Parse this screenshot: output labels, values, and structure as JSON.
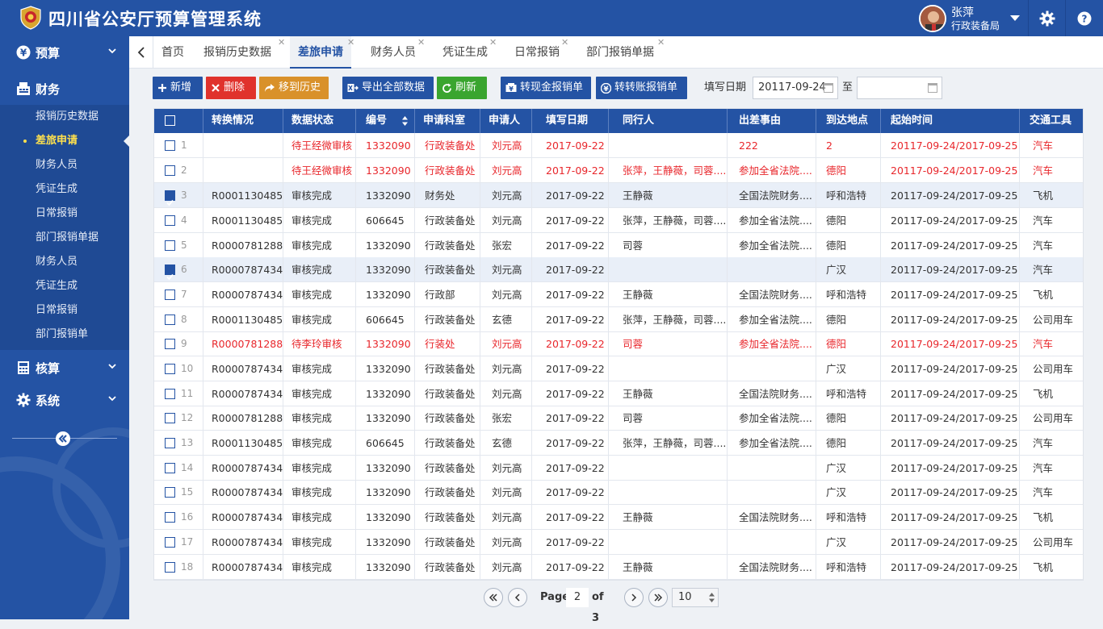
{
  "header": {
    "title": "四川省公安厅预算管理系统",
    "user_name": "张萍",
    "user_dept": "行政装备局"
  },
  "sidebar": {
    "groups": [
      {
        "label": "预算",
        "icon": "yen-circle-icon"
      },
      {
        "label": "财务",
        "icon": "cash-register-icon"
      },
      {
        "label": "核算",
        "icon": "calculator-icon"
      },
      {
        "label": "系统",
        "icon": "gear-icon"
      }
    ],
    "items": [
      {
        "label": "报销历史数据"
      },
      {
        "label": "差旅申请",
        "active": true
      },
      {
        "label": "财务人员"
      },
      {
        "label": "凭证生成"
      },
      {
        "label": "日常报销"
      },
      {
        "label": "部门报销单据"
      },
      {
        "label": "财务人员"
      },
      {
        "label": "凭证生成"
      },
      {
        "label": "日常报销"
      },
      {
        "label": "部门报销单"
      }
    ]
  },
  "tabs": [
    {
      "label": "首页",
      "closable": false
    },
    {
      "label": "报销历史数据",
      "closable": true
    },
    {
      "label": "差旅申请",
      "closable": true,
      "active": true
    },
    {
      "label": "财务人员",
      "closable": true
    },
    {
      "label": "凭证生成",
      "closable": true
    },
    {
      "label": "日常报销",
      "closable": true
    },
    {
      "label": "部门报销单据",
      "closable": true
    }
  ],
  "toolbar": {
    "add": "新增",
    "delete": "删除",
    "move_history": "移到历史",
    "export_all": "导出全部数据",
    "refresh": "刷新",
    "to_cash": "转现金报销单",
    "to_transfer": "转转账报销单",
    "date_label": "填写日期",
    "date_from": "20117-09-24",
    "date_to": "",
    "to_label": "至",
    "colors": {
      "add": "#2453a4",
      "delete": "#e0322c",
      "move": "#d9912a",
      "export": "#2453a4",
      "refresh": "#3aa52f",
      "to_cash": "#2453a4",
      "to_transfer": "#2453a4"
    }
  },
  "table": {
    "columns": [
      "转换情况",
      "数据状态",
      "编号",
      "申请科室",
      "申请人",
      "填写日期",
      "同行人",
      "出差事由",
      "到达地点",
      "起始时间",
      "交通工具"
    ],
    "rows": [
      {
        "n": "1",
        "checked": false,
        "red": true,
        "cells": [
          "",
          "待王经微审核",
          "1332090",
          "行政装备处",
          "刘元高",
          "2017-09-22",
          "",
          "222",
          "2",
          "20117-09-24/2017-09-25",
          "汽车"
        ]
      },
      {
        "n": "2",
        "checked": false,
        "red": true,
        "cells": [
          "",
          "待王经微审核",
          "1332090",
          "行政装备处",
          "刘元高",
          "2017-09-22",
          "张萍，王静薇，司蓉....",
          "参加全省法院....",
          "德阳",
          "20117-09-24/2017-09-25",
          "汽车"
        ]
      },
      {
        "n": "3",
        "checked": true,
        "red": false,
        "cells": [
          "R0001130485",
          "审核完成",
          "1332090",
          "财务处",
          "刘元高",
          "2017-09-22",
          "王静薇",
          "全国法院财务....",
          "呼和浩特",
          "20117-09-24/2017-09-25",
          "飞机"
        ]
      },
      {
        "n": "4",
        "checked": false,
        "red": false,
        "cells": [
          "R0001130485",
          "审核完成",
          "606645",
          "行政装备处",
          "刘元高",
          "2017-09-22",
          "张萍，王静薇，司蓉....",
          "参加全省法院....",
          "德阳",
          "20117-09-24/2017-09-25",
          "汽车"
        ]
      },
      {
        "n": "5",
        "checked": false,
        "red": false,
        "cells": [
          "R0000781288",
          "审核完成",
          "1332090",
          "行政装备处",
          "张宏",
          "2017-09-22",
          "司蓉",
          "参加全省法院....",
          "德阳",
          "20117-09-24/2017-09-25",
          "汽车"
        ]
      },
      {
        "n": "6",
        "checked": true,
        "red": false,
        "cells": [
          "R0000787434",
          "审核完成",
          "1332090",
          "行政装备处",
          "刘元高",
          "2017-09-22",
          "",
          "",
          "广汉",
          "20117-09-24/2017-09-25",
          "汽车"
        ]
      },
      {
        "n": "7",
        "checked": false,
        "red": false,
        "cells": [
          "R0000787434",
          "审核完成",
          "1332090",
          "行政部",
          "刘元高",
          "2017-09-22",
          "王静薇",
          "全国法院财务....",
          "呼和浩特",
          "20117-09-24/2017-09-25",
          "飞机"
        ]
      },
      {
        "n": "8",
        "checked": false,
        "red": false,
        "cells": [
          "R0001130485",
          "审核完成",
          "606645",
          "行政装备处",
          "玄德",
          "2017-09-22",
          "张萍，王静薇，司蓉....",
          "参加全省法院....",
          "德阳",
          "20117-09-24/2017-09-25",
          "公司用车"
        ]
      },
      {
        "n": "9",
        "checked": false,
        "red": true,
        "cells": [
          "R0000781288",
          "待李玲审核",
          "1332090",
          "行装处",
          "刘元高",
          "2017-09-22",
          "司蓉",
          "参加全省法院....",
          "德阳",
          "20117-09-24/2017-09-25",
          "汽车"
        ]
      },
      {
        "n": "10",
        "checked": false,
        "red": false,
        "cells": [
          "R0000787434",
          "审核完成",
          "1332090",
          "行政装备处",
          "刘元高",
          "2017-09-22",
          "",
          "",
          "广汉",
          "20117-09-24/2017-09-25",
          "公司用车"
        ]
      },
      {
        "n": "11",
        "checked": false,
        "red": false,
        "cells": [
          "R0000787434",
          "审核完成",
          "1332090",
          "行政装备处",
          "刘元高",
          "2017-09-22",
          "王静薇",
          "全国法院财务....",
          "呼和浩特",
          "20117-09-24/2017-09-25",
          "飞机"
        ]
      },
      {
        "n": "12",
        "checked": false,
        "red": false,
        "cells": [
          "R0000781288",
          "审核完成",
          "1332090",
          "行政装备处",
          "张宏",
          "2017-09-22",
          "司蓉",
          "参加全省法院....",
          "德阳",
          "20117-09-24/2017-09-25",
          "公司用车"
        ]
      },
      {
        "n": "13",
        "checked": false,
        "red": false,
        "cells": [
          "R0001130485",
          "审核完成",
          "606645",
          "行政装备处",
          "玄德",
          "2017-09-22",
          "张萍，王静薇，司蓉....",
          "参加全省法院....",
          "德阳",
          "20117-09-24/2017-09-25",
          "汽车"
        ]
      },
      {
        "n": "14",
        "checked": false,
        "red": false,
        "cells": [
          "R0000787434",
          "审核完成",
          "1332090",
          "行政装备处",
          "刘元高",
          "2017-09-22",
          "",
          "",
          "广汉",
          "20117-09-24/2017-09-25",
          "汽车"
        ]
      },
      {
        "n": "15",
        "checked": false,
        "red": false,
        "cells": [
          "R0000787434",
          "审核完成",
          "1332090",
          "行政装备处",
          "刘元高",
          "2017-09-22",
          "",
          "",
          "广汉",
          "20117-09-24/2017-09-25",
          "汽车"
        ]
      },
      {
        "n": "16",
        "checked": false,
        "red": false,
        "cells": [
          "R0000787434",
          "审核完成",
          "1332090",
          "行政装备处",
          "刘元高",
          "2017-09-22",
          "王静薇",
          "全国法院财务....",
          "呼和浩特",
          "20117-09-24/2017-09-25",
          "飞机"
        ]
      },
      {
        "n": "17",
        "checked": false,
        "red": false,
        "cells": [
          "R0000787434",
          "审核完成",
          "1332090",
          "行政装备处",
          "刘元高",
          "2017-09-22",
          "",
          "",
          "广汉",
          "20117-09-24/2017-09-25",
          "公司用车"
        ]
      },
      {
        "n": "18",
        "checked": false,
        "red": false,
        "cells": [
          "R0000787434",
          "审核完成",
          "1332090",
          "行政装备处",
          "刘元高",
          "2017-09-22",
          "王静薇",
          "全国法院财务....",
          "呼和浩特",
          "20117-09-24/2017-09-25",
          "飞机"
        ]
      }
    ]
  },
  "pager": {
    "page_label": "Page",
    "page": "2",
    "of_label": "of 3",
    "page_size": "10"
  }
}
